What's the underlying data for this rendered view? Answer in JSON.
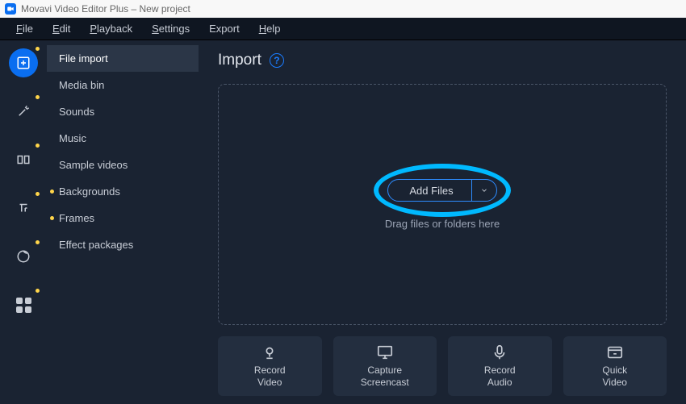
{
  "window": {
    "title": "Movavi Video Editor Plus – New project"
  },
  "menus": [
    "File",
    "Edit",
    "Playback",
    "Settings",
    "Export",
    "Help"
  ],
  "rail": [
    {
      "name": "import-icon",
      "has_dot": true,
      "active": true
    },
    {
      "name": "filters-icon",
      "has_dot": true,
      "active": false
    },
    {
      "name": "transitions-icon",
      "has_dot": true,
      "active": false
    },
    {
      "name": "titles-icon",
      "has_dot": true,
      "active": false
    },
    {
      "name": "stickers-icon",
      "has_dot": true,
      "active": false
    },
    {
      "name": "more-icon",
      "has_dot": true,
      "active": false
    }
  ],
  "sidebar": {
    "items": [
      {
        "label": "File import",
        "dot": false,
        "active": true
      },
      {
        "label": "Media bin",
        "dot": false,
        "active": false
      },
      {
        "label": "Sounds",
        "dot": false,
        "active": false
      },
      {
        "label": "Music",
        "dot": false,
        "active": false
      },
      {
        "label": "Sample videos",
        "dot": false,
        "active": false
      },
      {
        "label": "Backgrounds",
        "dot": true,
        "active": false
      },
      {
        "label": "Frames",
        "dot": true,
        "active": false
      },
      {
        "label": "Effect packages",
        "dot": false,
        "active": false
      }
    ]
  },
  "content": {
    "heading": "Import",
    "help_glyph": "?",
    "add_files_label": "Add Files",
    "dropzone_text": "Drag files or folders here"
  },
  "bottom_actions": [
    {
      "name": "record-video",
      "line1": "Record",
      "line2": "Video"
    },
    {
      "name": "capture-screencast",
      "line1": "Capture",
      "line2": "Screencast"
    },
    {
      "name": "record-audio",
      "line1": "Record",
      "line2": "Audio"
    },
    {
      "name": "quick-video",
      "line1": "Quick",
      "line2": "Video"
    }
  ]
}
